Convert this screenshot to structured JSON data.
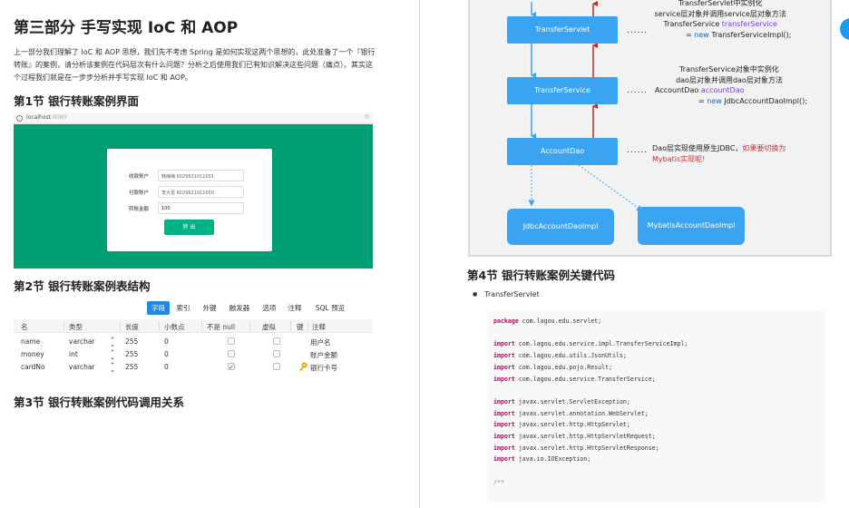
{
  "left": {
    "part_title": "第三部分 手写实现 IoC 和 AOP",
    "intro": "上一部分我们理解了 IoC 和 AOP 思想，我们先不考虑 Spring 是如何实现这两个思想的，此处准备了一个『银行转账』的案例，请分析该案例在代码层次有什么问题？分析之后使用我们已有知识解决这些问题（痛点）。其实这个过程我们就是在一步步分析并手写实现 IoC 和 AOP。",
    "sec1": "第1节 银行转账案例界面",
    "browser": {
      "url": "localhost",
      "port": ":8080",
      "form": {
        "payee_label": "收款账户",
        "payee_value": "韩梅梅 6029621011001",
        "payer_label": "付款账户",
        "payer_value": "李大雷 6029621011000",
        "amount_label": "转账金额",
        "amount_value": "100",
        "button": "转 出"
      }
    },
    "sec2": "第2节 银行转账案例表结构",
    "table_tabs": [
      "字段",
      "索引",
      "外键",
      "触发器",
      "选项",
      "注释",
      "SQL 预览"
    ],
    "table_columns": [
      "名",
      "类型",
      "长度",
      "小数点",
      "不是 null",
      "虚拟",
      "键",
      "注释"
    ],
    "table_rows": [
      {
        "name": "name",
        "type": "varchar",
        "length": "255",
        "decimal": "0",
        "comment": "用户名",
        "not_null": false,
        "key": false
      },
      {
        "name": "money",
        "type": "int",
        "length": "255",
        "decimal": "0",
        "comment": "账户金额",
        "not_null": false,
        "key": false
      },
      {
        "name": "cardNo",
        "type": "varchar",
        "length": "255",
        "decimal": "0",
        "comment": "银行卡号",
        "not_null": true,
        "key": true
      }
    ],
    "sec3": "第3节 银行转账案例代码调用关系"
  },
  "right": {
    "nodes": {
      "servlet": "TransferServlet",
      "service": "TransferService",
      "dao": "AccountDao",
      "jdbc": "JdbcAccountDaoImpl",
      "mybatis": "MybatisAccountDaoImpl"
    },
    "dots": "......",
    "note1": {
      "l1": "TransferServlet中实例化",
      "l2": "service层对象并调用service层对象方法",
      "l3a": "TransferService ",
      "l3b": "transferService",
      "l4a": "= ",
      "l4b": "new",
      "l4c": " TransferServiceImpl();"
    },
    "note2": {
      "l1": "TransferService对象中实例化",
      "l2": "dao层对象并调用dao层对象方法",
      "l3a": "AccountDao ",
      "l3b": "accountDao",
      "l4a": "= ",
      "l4b": "new",
      "l4c": " JdbcAccountDaoImpl();"
    },
    "note3": {
      "l1a": "Dao层实现使用原生JDBC，",
      "l1b": "如果要切换为",
      "l2": "Mybatis实现呢!"
    },
    "sec4": "第4节 银行转账案例关键代码",
    "bullet": "TransferServlet",
    "code": [
      {
        "kw": "package",
        "rest": " com.lagou.edu.servlet;"
      },
      {
        "kw": "",
        "rest": ""
      },
      {
        "kw": "import",
        "rest": " com.lagou.edu.service.impl.TransferServiceImpl;"
      },
      {
        "kw": "import",
        "rest": " com.lagou.edu.utils.JsonUtils;"
      },
      {
        "kw": "import",
        "rest": " com.lagou.edu.pojo.Result;"
      },
      {
        "kw": "import",
        "rest": " com.lagou.edu.service.TransferService;"
      },
      {
        "kw": "",
        "rest": ""
      },
      {
        "kw": "import",
        "rest": " javax.servlet.ServletException;"
      },
      {
        "kw": "import",
        "rest": " javax.servlet.annotation.WebServlet;"
      },
      {
        "kw": "import",
        "rest": " javax.servlet.http.HttpServlet;"
      },
      {
        "kw": "import",
        "rest": " javax.servlet.http.HttpServletRequest;"
      },
      {
        "kw": "import",
        "rest": " javax.servlet.http.HttpServletResponse;"
      },
      {
        "kw": "import",
        "rest": " java.io.IOException;"
      },
      {
        "kw": "",
        "rest": ""
      },
      {
        "kw": "",
        "rest": "/**"
      }
    ]
  }
}
